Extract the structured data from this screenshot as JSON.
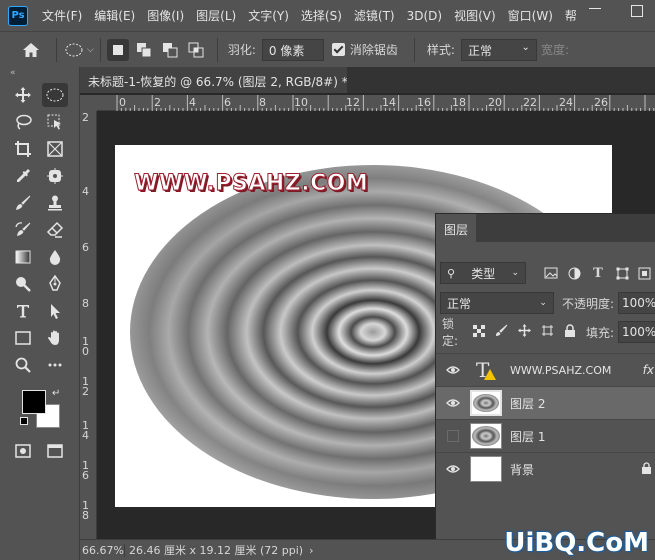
{
  "app": {
    "logo": "Ps"
  },
  "menu": [
    "文件(F)",
    "编辑(E)",
    "图像(I)",
    "图层(L)",
    "文字(Y)",
    "选择(S)",
    "滤镜(T)",
    "3D(D)",
    "视图(V)",
    "窗口(W)",
    "帮"
  ],
  "options_bar": {
    "feather_label": "羽化:",
    "feather_value": "0 像素",
    "antialias_label": "消除锯齿",
    "style_label": "样式:",
    "style_value": "正常",
    "width_label": "宽度:"
  },
  "document": {
    "tab_title": "未标题-1-恢复的 @ 66.7% (图层 2, RGB/8#) *",
    "close": "×",
    "canvas_text": "WWW.PSAHZ.COM",
    "ruler_top": [
      "0",
      "2",
      "4",
      "6",
      "8",
      "10",
      "12",
      "14",
      "16",
      "18",
      "20",
      "22",
      "24",
      "26"
    ],
    "ruler_left": [
      "2",
      "4",
      "6",
      "8",
      "1 0",
      "1 2",
      "1 4",
      "1 6",
      "1 8"
    ]
  },
  "status": {
    "zoom": "66.67%",
    "doc_size": "26.46 厘米 x 19.12 厘米 (72 ppi)",
    "arrow": "›"
  },
  "layers_panel": {
    "tab": "图层",
    "filter_label": "类型",
    "blend_mode": "正常",
    "opacity_label": "不透明度:",
    "opacity_value": "100%",
    "lock_label": "锁定:",
    "fill_label": "填充:",
    "fill_value": "100%",
    "layers": [
      {
        "name": "WWW.PSAHZ.COM",
        "type": "text",
        "visible": true,
        "selected": false,
        "fx": "fx"
      },
      {
        "name": "图层 2",
        "type": "pixel",
        "visible": true,
        "selected": true
      },
      {
        "name": "图层 1",
        "type": "pixel",
        "visible": false,
        "selected": false
      },
      {
        "name": "背景",
        "type": "background",
        "visible": true,
        "selected": false,
        "locked": true
      }
    ]
  },
  "watermark": "UiBQ.CoM"
}
